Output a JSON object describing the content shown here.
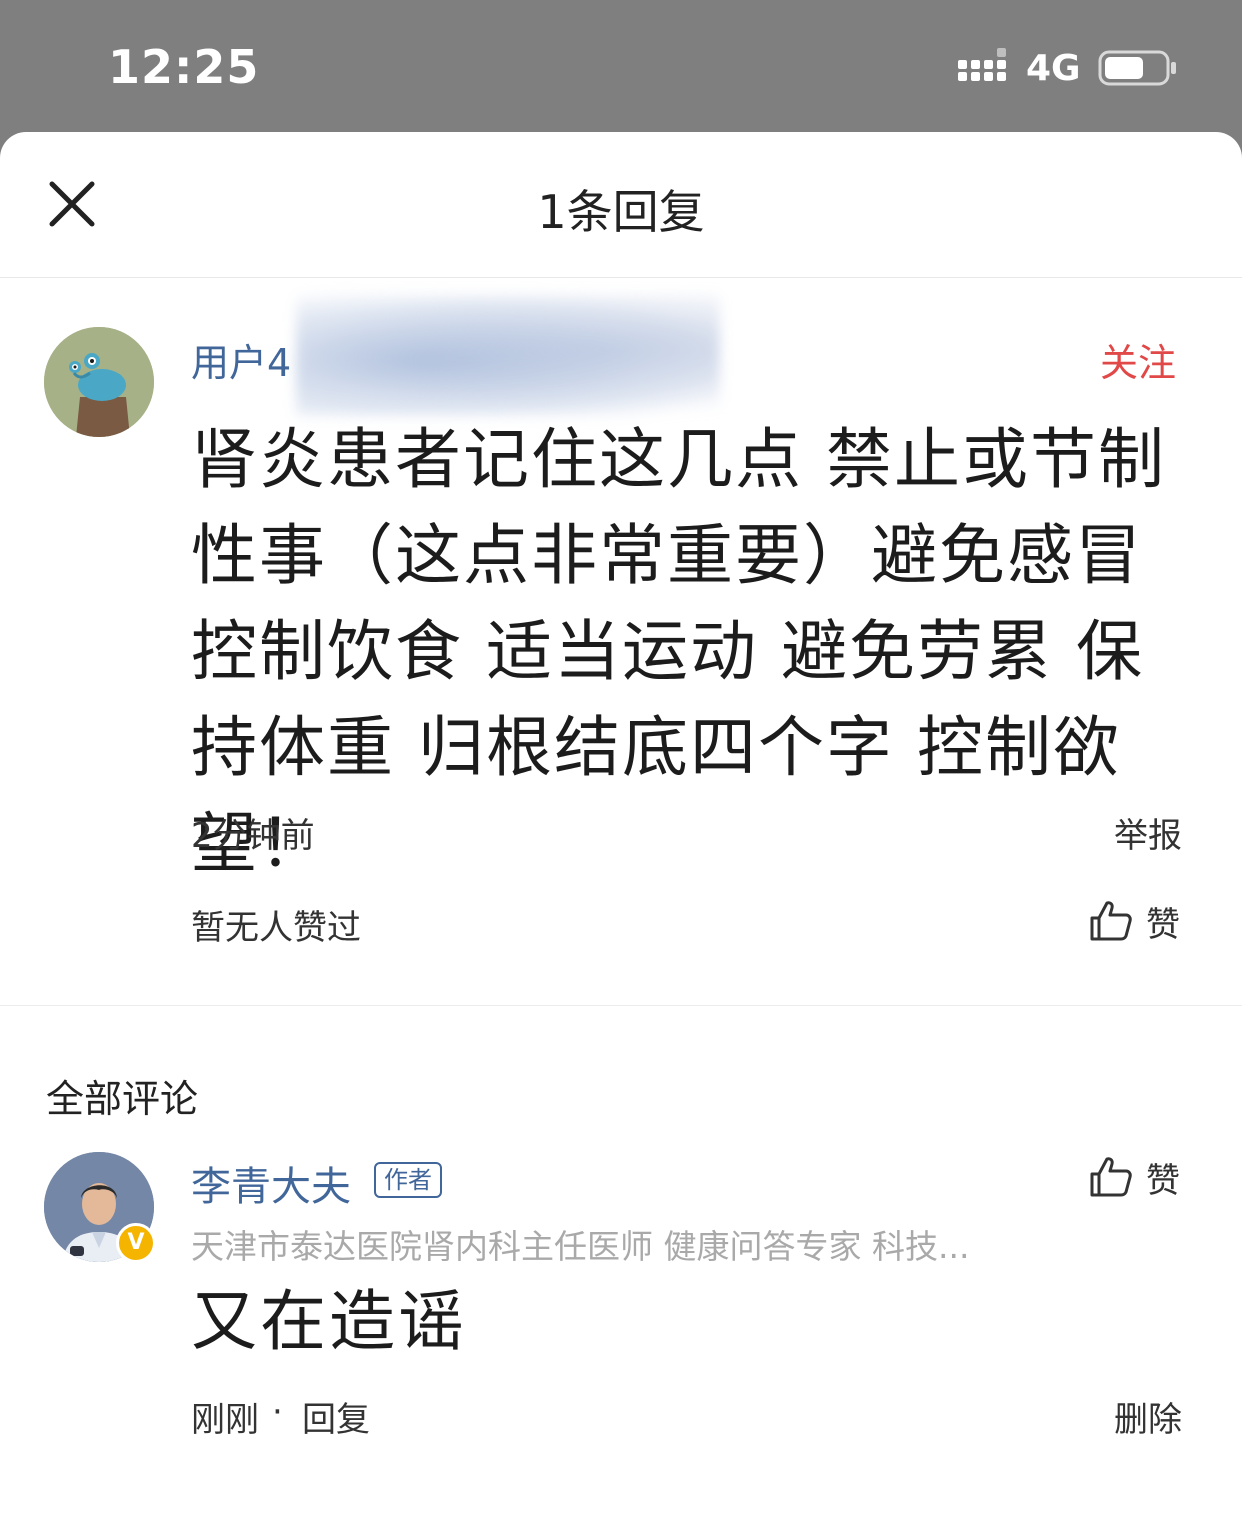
{
  "status_bar": {
    "time": "12:25",
    "network": "4G"
  },
  "header": {
    "title": "1条回复"
  },
  "comment": {
    "username": "用户4",
    "follow_label": "关注",
    "text": "肾炎患者记住这几点 禁止或节制性事（这点非常重要）避免感冒 控制饮食 适当运动 避免劳累 保持体重 归根结底四个字 控制欲望！",
    "time": "2分钟前",
    "report_label": "举报",
    "likes_summary": "暂无人赞过",
    "like_label": "赞"
  },
  "section": {
    "title": "全部评论"
  },
  "reply": {
    "author": "李青大夫",
    "author_tag": "作者",
    "badge": "V",
    "author_title": "天津市泰达医院肾内科主任医师 健康问答专家 科技...",
    "like_label": "赞",
    "text": "又在造谣",
    "time": "刚刚",
    "separator": "·",
    "reply_label": "回复",
    "delete_label": "删除"
  },
  "colors": {
    "link_blue": "#41669a",
    "follow_red": "#e14848",
    "badge_yellow": "#f4b400"
  }
}
